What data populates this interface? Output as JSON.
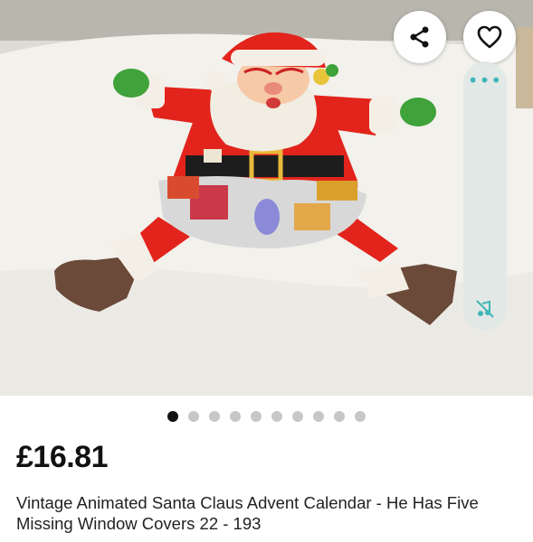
{
  "listing": {
    "image_description": "Santa Claus advent calendar photo",
    "price": "£16.81",
    "title": "Vintage Animated Santa Claus Advent Calendar - He Has Five Missing Window Covers 22 - 193"
  },
  "actions": {
    "share_icon": "share-icon",
    "favorite_icon": "heart-icon"
  },
  "side_panel": {
    "more_icon": "more-dots-icon",
    "mute_icon": "mute-icon"
  },
  "gallery": {
    "total_images": 10,
    "active_index": 0
  },
  "colors": {
    "accent": "#3fb6b8",
    "active_dot": "#111111",
    "inactive_dot": "#c7c7c7"
  }
}
